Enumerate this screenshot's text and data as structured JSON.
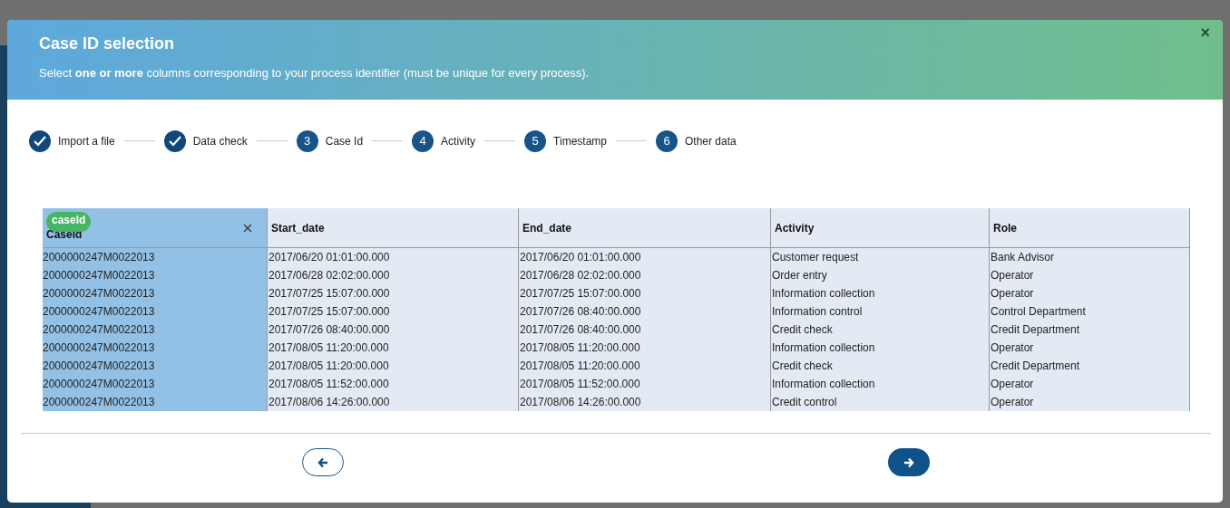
{
  "dialog": {
    "title": "Case ID selection",
    "subtitle": "Select **one or more** columns corresponding to your process identifier (must be unique for every process).",
    "close": "×"
  },
  "steps": [
    {
      "label": "Import a file",
      "done": true
    },
    {
      "label": "Data check",
      "done": true
    },
    {
      "label": "Case Id",
      "done": false,
      "number": "3"
    },
    {
      "label": "Activity",
      "done": false,
      "number": "4"
    },
    {
      "label": "Timestamp",
      "done": false,
      "number": "5"
    },
    {
      "label": "Other data",
      "done": false,
      "number": "6"
    }
  ],
  "table": {
    "columns": [
      {
        "label": "CaseId",
        "selected": true,
        "tag": "caseId"
      },
      {
        "label": "Start_date",
        "selected": false
      },
      {
        "label": "End_date",
        "selected": false
      },
      {
        "label": "Activity",
        "selected": false
      },
      {
        "label": "Role",
        "selected": false
      }
    ],
    "rows": [
      [
        "2000000247M0022013",
        "2017/06/20 01:01:00.000",
        "2017/06/20 01:01:00.000",
        "Customer request",
        "Bank Advisor"
      ],
      [
        "2000000247M0022013",
        "2017/06/28 02:02:00.000",
        "2017/06/28 02:02:00.000",
        "Order entry",
        "Operator"
      ],
      [
        "2000000247M0022013",
        "2017/07/25 15:07:00.000",
        "2017/07/25 15:07:00.000",
        "Information collection",
        "Operator"
      ],
      [
        "2000000247M0022013",
        "2017/07/25 15:07:00.000",
        "2017/07/26 08:40:00.000",
        "Information control",
        "Control Department"
      ],
      [
        "2000000247M0022013",
        "2017/07/26 08:40:00.000",
        "2017/07/26 08:40:00.000",
        "Credit check",
        "Credit Department"
      ],
      [
        "2000000247M0022013",
        "2017/08/05 11:20:00.000",
        "2017/08/05 11:20:00.000",
        "Information collection",
        "Operator"
      ],
      [
        "2000000247M0022013",
        "2017/08/05 11:20:00.000",
        "2017/08/05 11:20:00.000",
        "Credit check",
        "Credit Department"
      ],
      [
        "2000000247M0022013",
        "2017/08/05 11:52:00.000",
        "2017/08/05 11:52:00.000",
        "Information collection",
        "Operator"
      ],
      [
        "2000000247M0022013",
        "2017/08/06 14:26:00.000",
        "2017/08/06 14:26:00.000",
        "Credit control",
        "Operator"
      ]
    ]
  }
}
